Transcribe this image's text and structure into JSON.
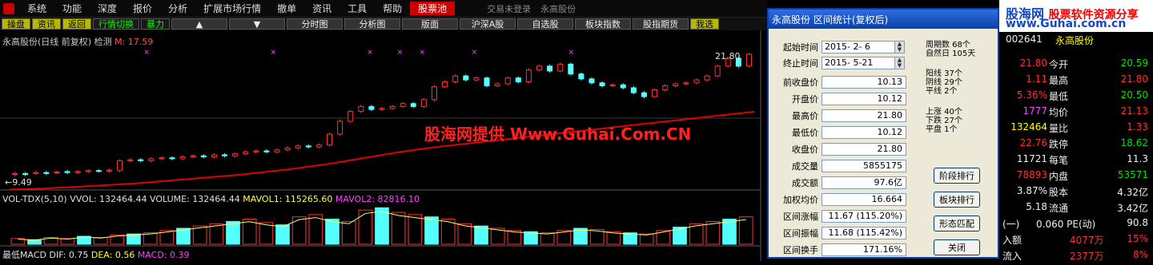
{
  "menu": {
    "items": [
      "系统",
      "功能",
      "深度",
      "报价",
      "分析",
      "扩展市场行情",
      "撤单",
      "资讯",
      "工具",
      "帮助"
    ],
    "hot": "股票池",
    "status": "交易未登录",
    "stock": "永高股份"
  },
  "toolbar": {
    "items": [
      "操盘",
      "资讯",
      "返回",
      "行情切换",
      "暴力",
      "▲",
      "▼",
      "分时图",
      "分析图",
      "版面",
      "沪深A股",
      "自选股",
      "板块指数",
      "股指期货",
      "我选"
    ]
  },
  "chart": {
    "header": "永高股份(日线 前复权) 检测",
    "ma_label": "M: 17.59",
    "high_label": "21.80",
    "low_label": "←9.49",
    "watermark": "股海网提供 Www.Guhai.Com.CN",
    "vol_header": {
      "name": "VOL-TDX(5,10)",
      "vvol": "VVOL: 132464.44",
      "volume": "VOLUME: 132464.44",
      "mavol1": "MAVOL1: 115265.60",
      "mavol2": "MAVOL2: 82816.10"
    },
    "macd_header": {
      "name": "最低MACD",
      "dif": "DIF: 0.75",
      "dea": "DEA: 0.56",
      "macd": "MACD: 0.39"
    },
    "colors": {
      "up": "#ff3232",
      "down": "#54ffff",
      "ma": "#e00000",
      "vol_line": "#ffff66"
    }
  },
  "chart_data": {
    "type": "candlestick",
    "ylim": [
      9.49,
      21.8
    ],
    "candles": [
      [
        9.6,
        9.7
      ],
      [
        9.7,
        9.6
      ],
      [
        9.7,
        9.8
      ],
      [
        9.8,
        9.7
      ],
      [
        9.8,
        9.85
      ],
      [
        9.9,
        9.8
      ],
      [
        9.8,
        9.9
      ],
      [
        9.9,
        10.0
      ],
      [
        10.0,
        9.95
      ],
      [
        9.95,
        10.05
      ],
      [
        10.0,
        11.0
      ],
      [
        11.0,
        11.1
      ],
      [
        11.1,
        11.0
      ],
      [
        11.0,
        11.2
      ],
      [
        11.2,
        11.3
      ],
      [
        11.3,
        11.2
      ],
      [
        11.2,
        11.4
      ],
      [
        11.4,
        11.5
      ],
      [
        11.5,
        11.4
      ],
      [
        11.4,
        11.6
      ],
      [
        11.6,
        11.5
      ],
      [
        11.5,
        11.7
      ],
      [
        11.7,
        11.9
      ],
      [
        11.9,
        12.0
      ],
      [
        12.0,
        11.9
      ],
      [
        11.9,
        12.1
      ],
      [
        12.1,
        12.3
      ],
      [
        12.3,
        12.5
      ],
      [
        12.5,
        12.4
      ],
      [
        12.4,
        12.6
      ],
      [
        12.6,
        13.7
      ],
      [
        13.7,
        15.0
      ],
      [
        15.0,
        16.0
      ],
      [
        16.0,
        16.5
      ],
      [
        16.5,
        16.2
      ],
      [
        16.2,
        16.3
      ],
      [
        16.3,
        16.5
      ],
      [
        16.5,
        16.8
      ],
      [
        16.8,
        16.5
      ],
      [
        16.5,
        17.2
      ],
      [
        17.2,
        18.5
      ],
      [
        18.5,
        19.0
      ],
      [
        19.0,
        19.6
      ],
      [
        19.6,
        19.2
      ],
      [
        19.2,
        19.4
      ],
      [
        19.4,
        18.6
      ],
      [
        18.6,
        18.8
      ],
      [
        18.8,
        19.4
      ],
      [
        19.4,
        19.0
      ],
      [
        19.0,
        20.2
      ],
      [
        20.2,
        20.6
      ],
      [
        20.6,
        20.1
      ],
      [
        20.1,
        20.8
      ],
      [
        20.8,
        19.8
      ],
      [
        19.8,
        19.3
      ],
      [
        19.3,
        18.9
      ],
      [
        18.9,
        18.6
      ],
      [
        18.6,
        18.7
      ],
      [
        18.7,
        18.4
      ],
      [
        18.4,
        17.9
      ],
      [
        17.9,
        17.5
      ],
      [
        17.5,
        18.2
      ],
      [
        18.2,
        18.6
      ],
      [
        18.6,
        18.8
      ],
      [
        18.8,
        18.9
      ],
      [
        18.9,
        19.2
      ],
      [
        19.2,
        19.6
      ],
      [
        19.6,
        20.6
      ],
      [
        20.6,
        21.4
      ],
      [
        21.4,
        20.6
      ],
      [
        20.6,
        21.8
      ]
    ],
    "ma": [
      9.7,
      9.75,
      9.8,
      9.9,
      10.0,
      10.1,
      10.2,
      10.3,
      10.45,
      10.6,
      10.75,
      10.9,
      11.05,
      11.2,
      11.4,
      11.6,
      11.8,
      12.05,
      12.3,
      12.6,
      12.9,
      13.2,
      13.5,
      13.75,
      14.0,
      14.2,
      14.4,
      14.6,
      14.8,
      15.0,
      15.2,
      15.4,
      15.6,
      15.8,
      16.0,
      16.2,
      16.4,
      16.6,
      16.8,
      17.0,
      17.2,
      17.4,
      17.59
    ],
    "volume": [
      5,
      4,
      6,
      5,
      7,
      6,
      8,
      9,
      10,
      12,
      14,
      16,
      18,
      20,
      22,
      19,
      17,
      24,
      26,
      22,
      20,
      30,
      32,
      28,
      26,
      24,
      22,
      18,
      16,
      14,
      12,
      11,
      10,
      12,
      14,
      13,
      11,
      10,
      9,
      12,
      15,
      18,
      20,
      22,
      24
    ]
  },
  "dialog": {
    "title": "永高股份  区间统计(复权后)",
    "start_label": "起始时间",
    "start": "2015- 2- 6",
    "end_label": "终止时间",
    "end": "2015- 5-21",
    "fields": [
      {
        "label": "前收盘价",
        "value": "10.13"
      },
      {
        "label": "开盘价",
        "value": "10.12"
      },
      {
        "label": "最高价",
        "value": "21.80"
      },
      {
        "label": "最低价",
        "value": "10.12"
      },
      {
        "label": "收盘价",
        "value": "21.80"
      },
      {
        "label": "成交量",
        "value": "5855175"
      },
      {
        "label": "成交额",
        "value": "97.6亿"
      },
      {
        "label": "加权均价",
        "value": "16.664"
      },
      {
        "label": "区间涨幅",
        "value": "11.67 (115.20%)"
      },
      {
        "label": "区间振幅",
        "value": "11.68 (115.42%)"
      },
      {
        "label": "区间换手",
        "value": "171.16%"
      }
    ],
    "stats": [
      "周期数 68个",
      "自然日 105天",
      "阳线 37个",
      "阴线 29个",
      "平线 2个",
      "上涨 40个",
      "下跌 27个",
      "平盘 1个"
    ],
    "buttons": [
      "阶段排行",
      "板块排行",
      "形态匹配",
      "关闭"
    ]
  },
  "brand": {
    "name": "股海网",
    "tag": "股票软件资源分享",
    "url": "www.Guhai.com.cn"
  },
  "quote": {
    "rows": [
      {
        "l": "002641",
        "lt": "永高股份",
        "r": ""
      },
      {
        "l": "21.80",
        "k": "今开",
        "r": "20.59"
      },
      {
        "l": "1.11",
        "k": "最高",
        "r": "21.80"
      },
      {
        "l": "5.36%",
        "k": "最低",
        "r": "20.50"
      },
      {
        "l": "1777",
        "k": "均价",
        "r": "21.13"
      },
      {
        "l": "132464",
        "k": "量比",
        "r": "1.33"
      },
      {
        "l": "22.76",
        "k": "跌停",
        "r": "18.62"
      },
      {
        "l": "11721",
        "k": "每笔",
        "r": "11.3"
      },
      {
        "l": "78893",
        "k": "内盘",
        "r": "53571"
      },
      {
        "l": "3.87%",
        "k": "股本",
        "r": "4.32亿"
      },
      {
        "l": "5.18",
        "k": "流通",
        "r": "3.42亿"
      },
      {
        "l": "(一)",
        "k": "0.060 PE(动)",
        "r": "90.8"
      },
      {
        "l": "入额",
        "k": "4077万",
        "r": "15%"
      },
      {
        "l": "流入",
        "k": "2377万",
        "r": "8%"
      }
    ]
  }
}
